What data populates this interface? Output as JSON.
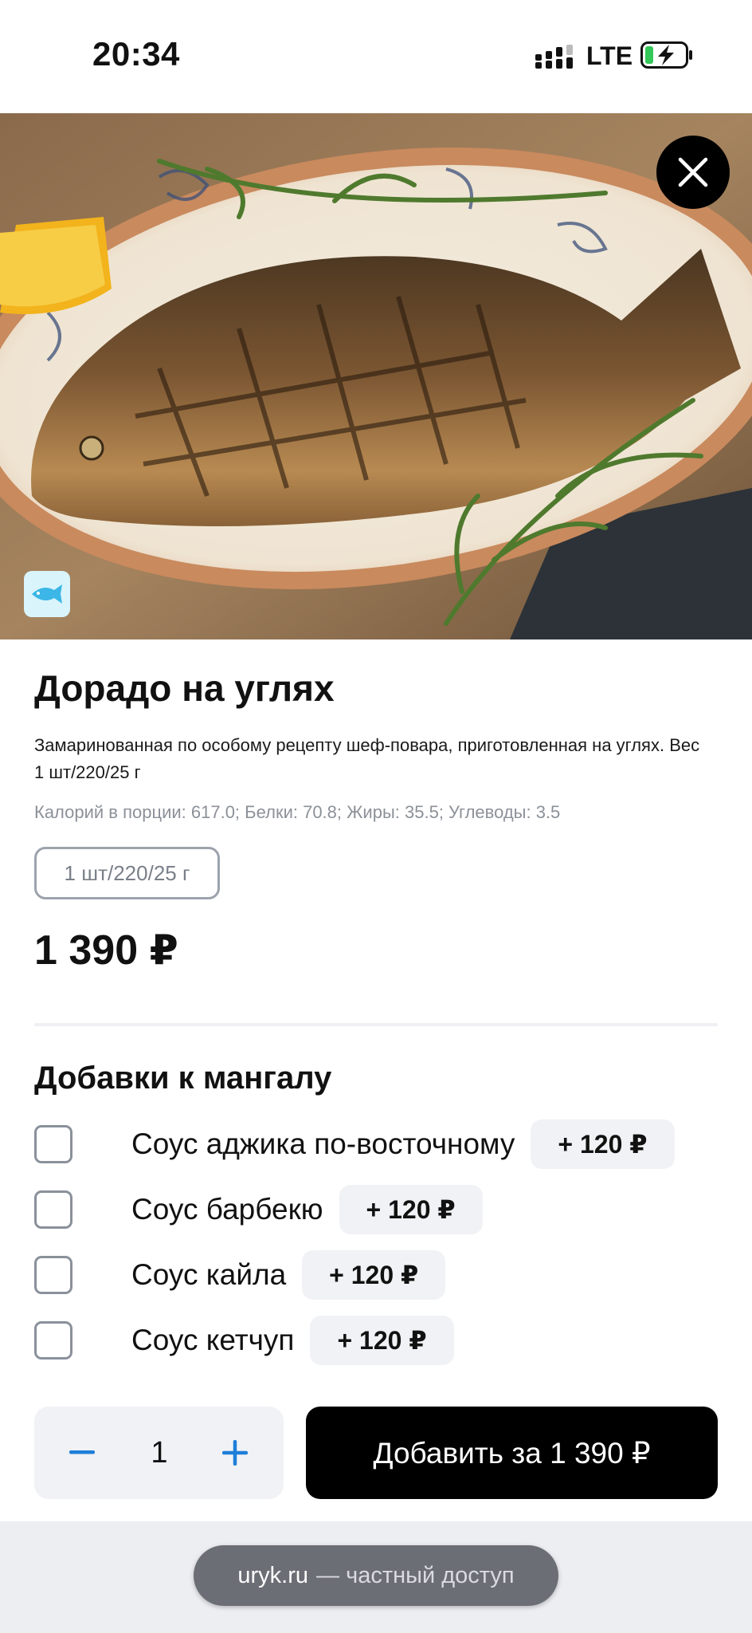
{
  "status_bar": {
    "time": "20:34",
    "network": "LTE",
    "signal_icon": "cellular-signal-icon",
    "battery_icon": "battery-charging-icon"
  },
  "hero": {
    "image_icon": "grilled-fish-photo",
    "close_icon": "close-icon",
    "badge_icon": "fish-icon"
  },
  "product": {
    "title": "Дорадо на углях",
    "description": "Замаринованная по особому рецепту шеф-повара, приготовленная на углях. Вес 1 шт/220/25 г",
    "nutrition": "Калорий в порции: 617.0; Белки: 70.8; Жиры: 35.5; Углеводы: 3.5",
    "portion_option": "1 шт/220/25 г",
    "price": "1 390 ₽"
  },
  "addons": {
    "title": "Добавки к мангалу",
    "items": [
      {
        "label": "Соус аджика по-восточному",
        "price": "+ 120 ₽",
        "checked": false
      },
      {
        "label": "Соус барбекю",
        "price": "+ 120 ₽",
        "checked": false
      },
      {
        "label": "Соус кайла",
        "price": "+ 120 ₽",
        "checked": false
      },
      {
        "label": "Соус кетчуп",
        "price": "+ 120 ₽",
        "checked": false
      }
    ]
  },
  "cart": {
    "quantity": "1",
    "minus_icon": "minus-icon",
    "plus_icon": "plus-icon",
    "add_button_label": "Добавить за 1 390 ₽"
  },
  "browser": {
    "domain": "uryk.ru",
    "access_note": "— частный доступ"
  },
  "colors": {
    "accent": "#1e7ed8",
    "button_bg": "#000000",
    "chip_bg": "#f1f2f5",
    "muted_text": "#8c9199"
  }
}
